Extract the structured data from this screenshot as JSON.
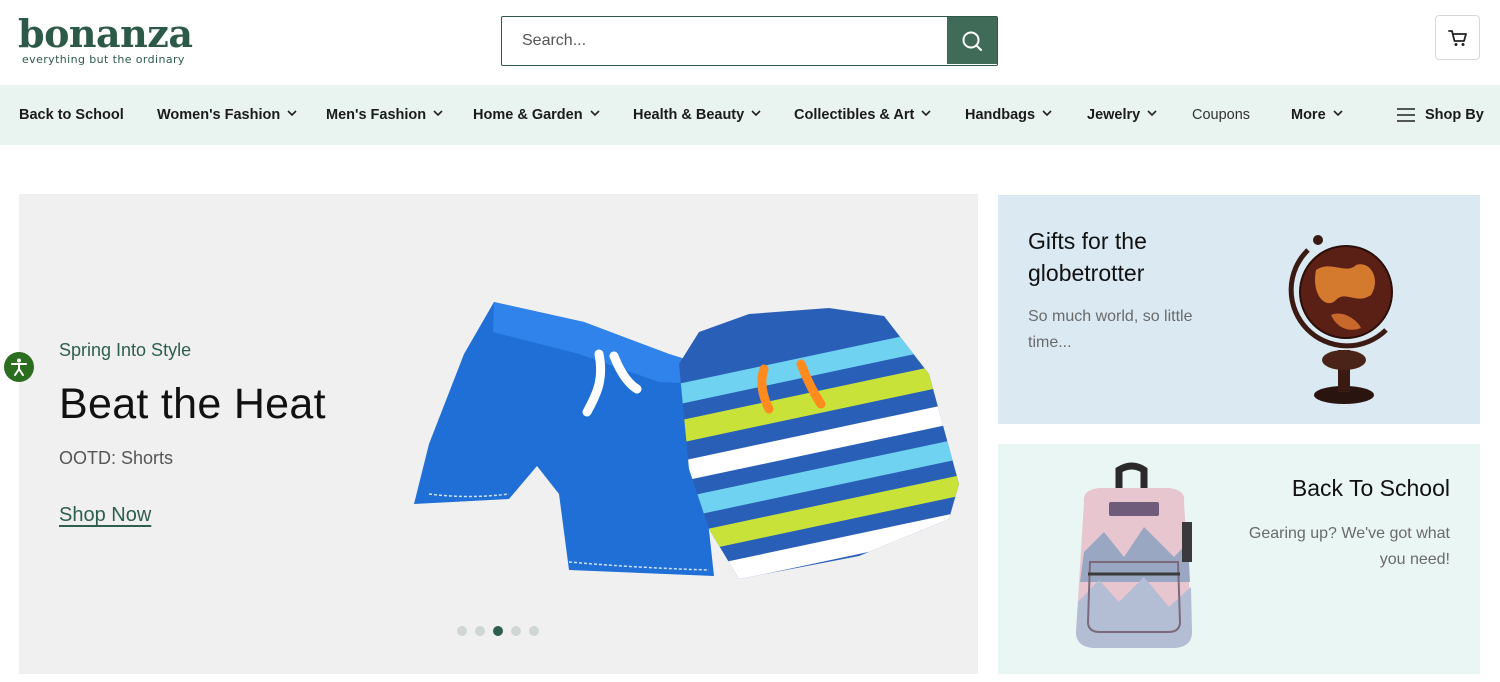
{
  "header": {
    "logo_text": "bonanza",
    "logo_tagline": "everything but the ordinary",
    "search_placeholder": "Search..."
  },
  "nav": {
    "items": [
      {
        "label": "Back to School"
      },
      {
        "label": "Women's Fashion"
      },
      {
        "label": "Men's Fashion"
      },
      {
        "label": "Home & Garden"
      },
      {
        "label": "Health & Beauty"
      },
      {
        "label": "Collectibles & Art"
      },
      {
        "label": "Handbags"
      },
      {
        "label": "Jewelry"
      },
      {
        "label": "Coupons"
      },
      {
        "label": "More"
      }
    ],
    "shop_by": "Shop By"
  },
  "hero": {
    "eyebrow": "Spring Into Style",
    "title": "Beat the Heat",
    "subtitle": "OOTD: Shorts",
    "cta": "Shop Now",
    "slide_count": 5,
    "active_slide": 3
  },
  "promo_cards": [
    {
      "title": "Gifts for the globetrotter",
      "subtitle": "So much world, so little time..."
    },
    {
      "title": "Back To School",
      "subtitle": "Gearing up? We've got what you need!"
    }
  ],
  "colors": {
    "brand": "#2d5a48",
    "nav_bg": "#e9f3f0",
    "card_blue": "#dbe9f3",
    "card_mint": "#eaf6f4"
  }
}
